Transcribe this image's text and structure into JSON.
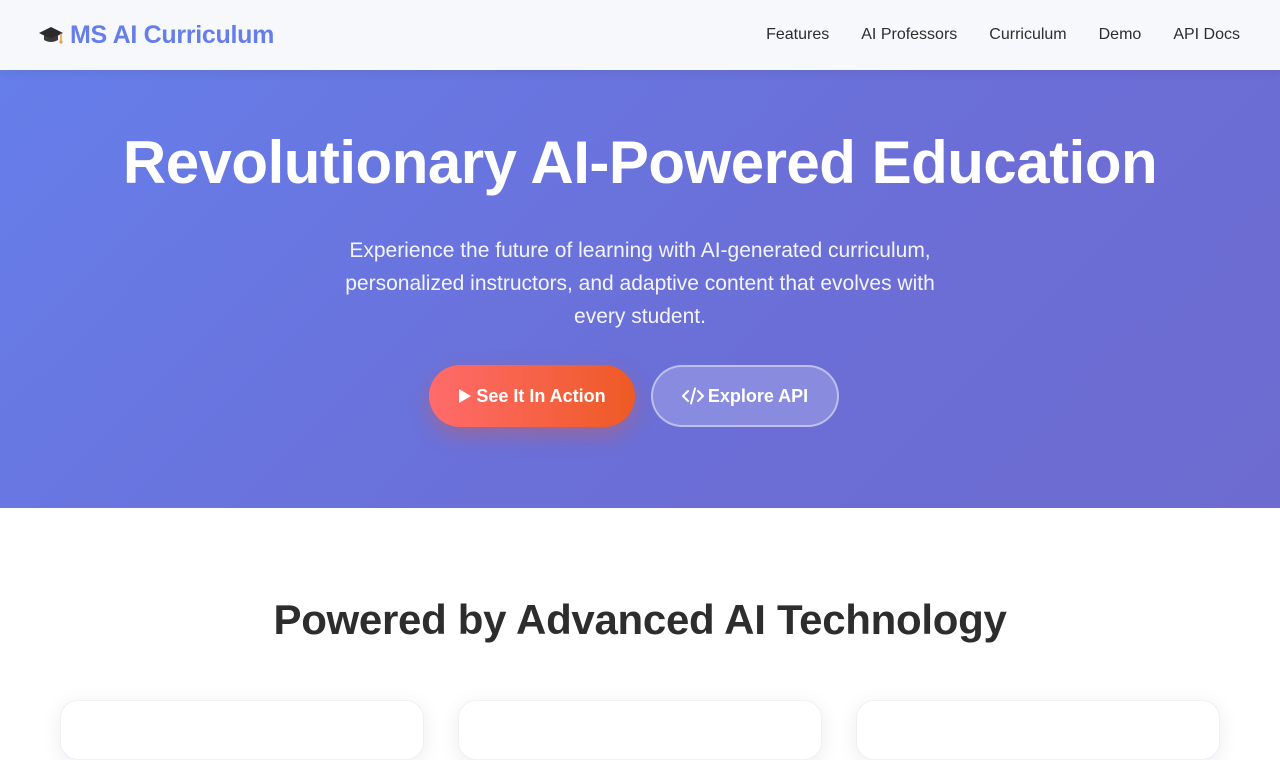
{
  "brand": {
    "name": "MS AI Curriculum",
    "icon": "graduation-cap-icon"
  },
  "nav": {
    "links": [
      "Features",
      "AI Professors",
      "Curriculum",
      "Demo",
      "API Docs"
    ]
  },
  "hero": {
    "title": "Revolutionary AI-Powered Education",
    "subtitle": "Experience the future of learning with AI-generated curriculum, personalized instructors, and adaptive content that evolves with every student.",
    "primary_button": {
      "label": "See It In Action",
      "icon": "play-icon"
    },
    "secondary_button": {
      "label": "Explore API",
      "icon": "code-icon"
    }
  },
  "features": {
    "title": "Powered by Advanced AI Technology"
  },
  "colors": {
    "brand": "#667eea",
    "hero_gradient_start": "#667eea",
    "hero_gradient_end": "#6d6bd0",
    "primary_button_start": "#ff6b6b",
    "primary_button_end": "#ee5a24"
  }
}
